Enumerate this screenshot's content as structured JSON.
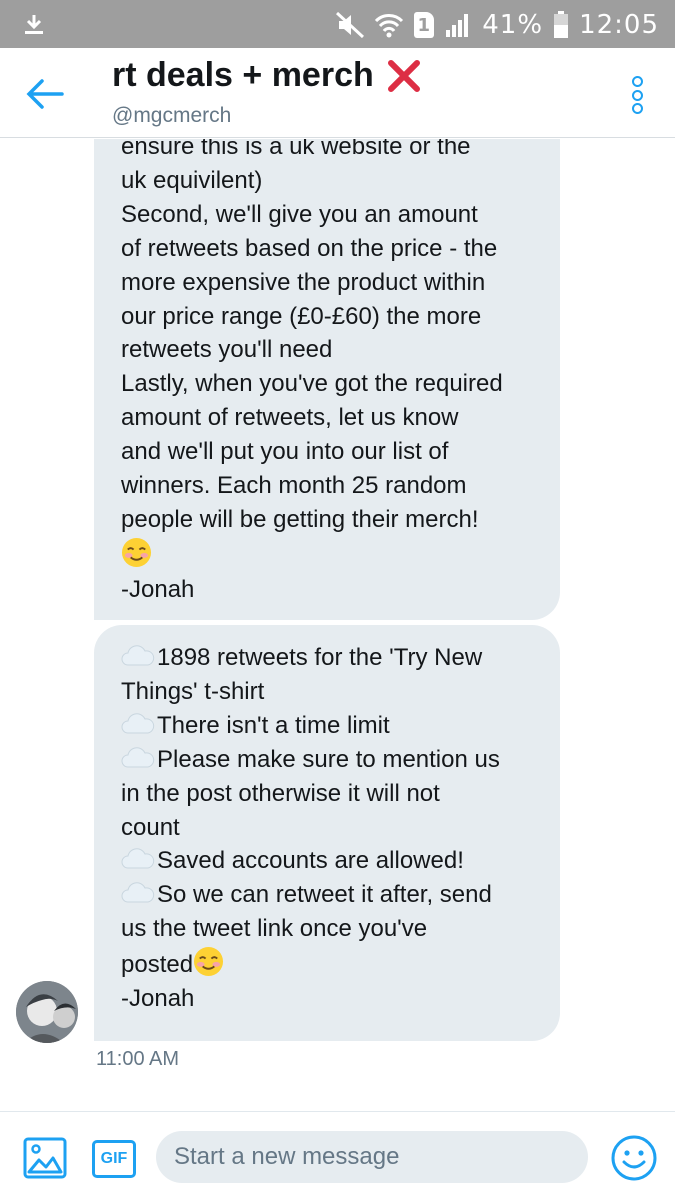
{
  "status_bar": {
    "battery_percent": "41%",
    "time": "12:05",
    "sim_slot": "1",
    "icons": [
      "download-icon",
      "mute-icon",
      "wifi-icon",
      "signal-icon",
      "battery-icon"
    ]
  },
  "header": {
    "title": "rt deals + merch",
    "title_emoji": "cross-mark-icon",
    "handle": "@mgcmerch",
    "accent_color": "#1da1f2"
  },
  "messages": [
    {
      "lines": [
        "ensure this is a uk website or the",
        "uk equivilent)",
        "Second, we'll give you an amount",
        "of retweets based on the price - the",
        "more expensive the product within",
        "our price range (£0-£60) the more",
        "retweets you'll need",
        "Lastly, when you've got the required",
        "amount of retweets, let us know",
        "and we'll put you into our list of",
        "winners. Each month 25 random",
        "people will be getting their merch!",
        "",
        "-Jonah"
      ]
    },
    {
      "lines": [
        "1898 retweets for the 'Try New",
        "Things' t-shirt",
        "There isn't a time limit",
        "Please make sure to mention us",
        "in the post otherwise it will not",
        "count",
        "Saved accounts are allowed!",
        "So we can retweet it after, send",
        "us the tweet link once you've",
        "posted",
        "-Jonah"
      ],
      "timestamp": "11:00 AM"
    }
  ],
  "composer": {
    "placeholder": "Start a new message",
    "gif_label": "GIF"
  },
  "colors": {
    "bubble": "#e6ecf0",
    "status_bar": "#9e9e9e",
    "muted_text": "#657786"
  }
}
